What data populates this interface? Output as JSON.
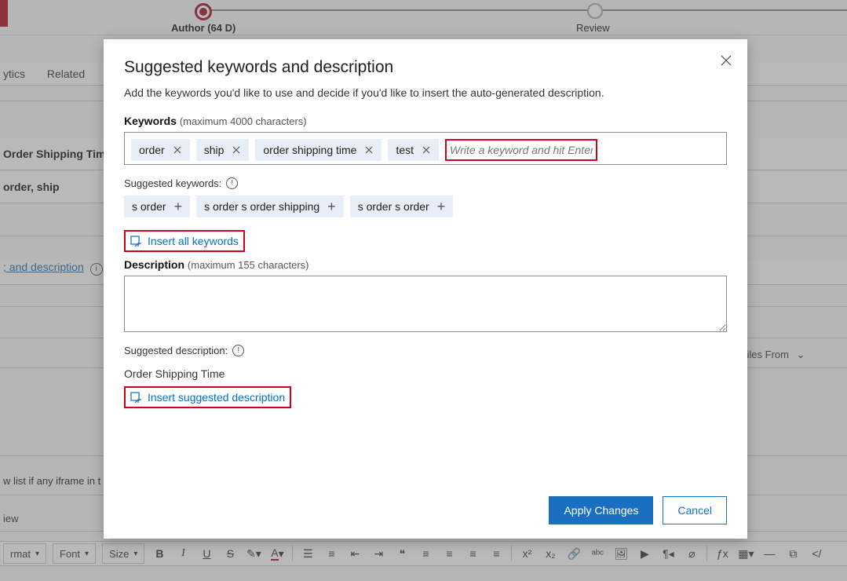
{
  "wizard": {
    "author_label": "Author  (64 D)",
    "review_label": "Review"
  },
  "bg": {
    "tab_ytics": "ytics",
    "tab_related": "Related",
    "title_row": "Order Shipping Time",
    "keywords_row": "order, ship",
    "link_text": "; and description",
    "attach": "ach Files From",
    "note": "w list if any iframe in t",
    "preview": "iew"
  },
  "toolbar": {
    "format": "rmat",
    "font": "Font",
    "size": "Size",
    "bold": "B",
    "italic": "I",
    "underline": "U",
    "strike": "S"
  },
  "modal": {
    "title": "Suggested keywords and description",
    "subtitle": "Add the keywords you'd like to use and decide if you'd like to insert the auto-generated description.",
    "keywords_label": "Keywords",
    "keywords_hint": "(maximum 4000 characters)",
    "chips": [
      "order",
      "ship",
      "order shipping time",
      "test"
    ],
    "kw_input_placeholder": "Write a keyword and hit Enter",
    "suggested_label": "Suggested keywords:",
    "suggested_chips": [
      "s order",
      "s order s order shipping",
      "s order s order"
    ],
    "insert_all": "Insert all keywords",
    "description_label": "Description",
    "description_hint": "(maximum 155 characters)",
    "suggested_desc_label": "Suggested description:",
    "suggested_desc_text": "Order Shipping Time",
    "insert_desc": "Insert suggested description",
    "apply": "Apply Changes",
    "cancel": "Cancel"
  }
}
